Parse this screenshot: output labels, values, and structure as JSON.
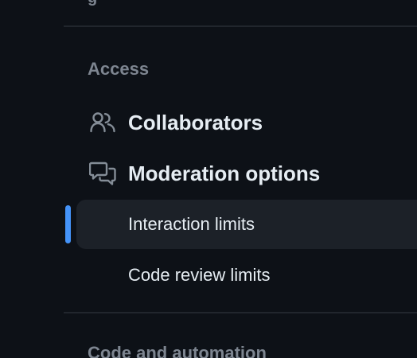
{
  "sidebar": {
    "previous_fragment": "g",
    "access_heading": "Access",
    "items": [
      {
        "label": "Collaborators",
        "icon": "people-icon"
      },
      {
        "label": "Moderation options",
        "icon": "comment-discussion-icon"
      },
      {
        "label": "Interaction limits",
        "active": true
      },
      {
        "label": "Code review limits"
      }
    ],
    "next_heading": "Code and automation"
  },
  "colors": {
    "background": "#0d1117",
    "active_indicator": "#4493f8",
    "active_row": "#1c2128",
    "heading": "#7d8590",
    "text": "#e6edf3"
  }
}
